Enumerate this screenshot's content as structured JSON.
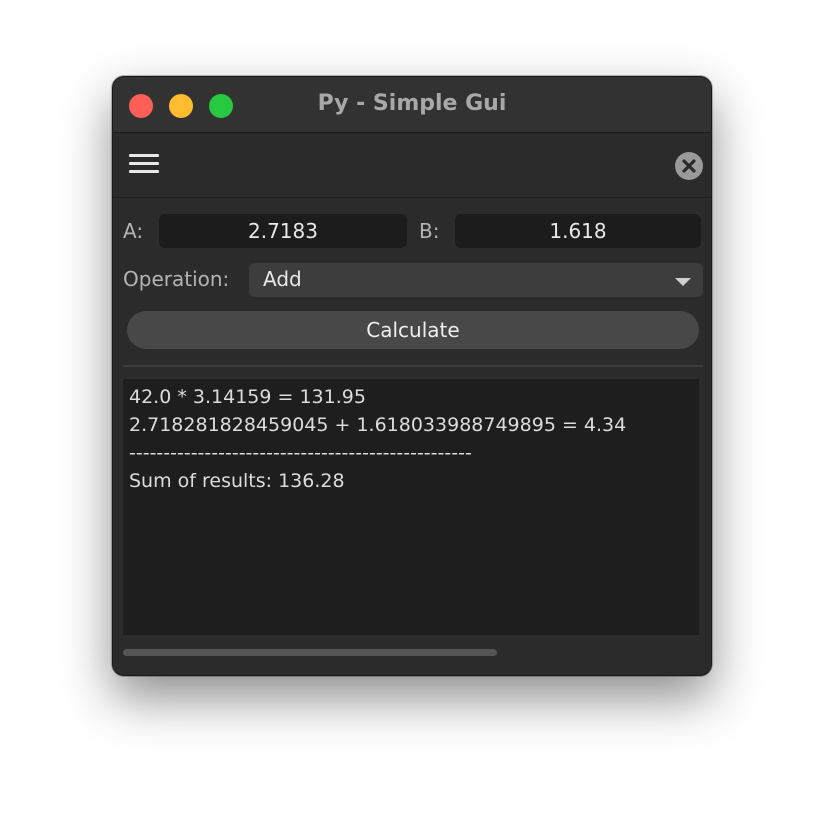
{
  "window": {
    "title": "Py - Simple Gui"
  },
  "form": {
    "a_label": "A:",
    "a_value": "2.7183",
    "b_label": "B:",
    "b_value": "1.618",
    "operation_label": "Operation:",
    "operation_value": "Add",
    "calculate_label": "Calculate"
  },
  "output": {
    "lines": [
      "42.0 * 3.14159 = 131.95",
      "2.718281828459045 + 1.618033988749895 = 4.34",
      "--------------------------------------------------",
      "Sum of results: 136.28"
    ]
  },
  "colors": {
    "close": "#ff5f57",
    "minimize": "#febc2e",
    "zoom": "#28c840",
    "window_bg": "#2b2b2b",
    "field_bg": "#1c1c1c"
  },
  "icons": [
    "hamburger-menu-icon",
    "close-circle-icon",
    "chevron-down-icon"
  ]
}
